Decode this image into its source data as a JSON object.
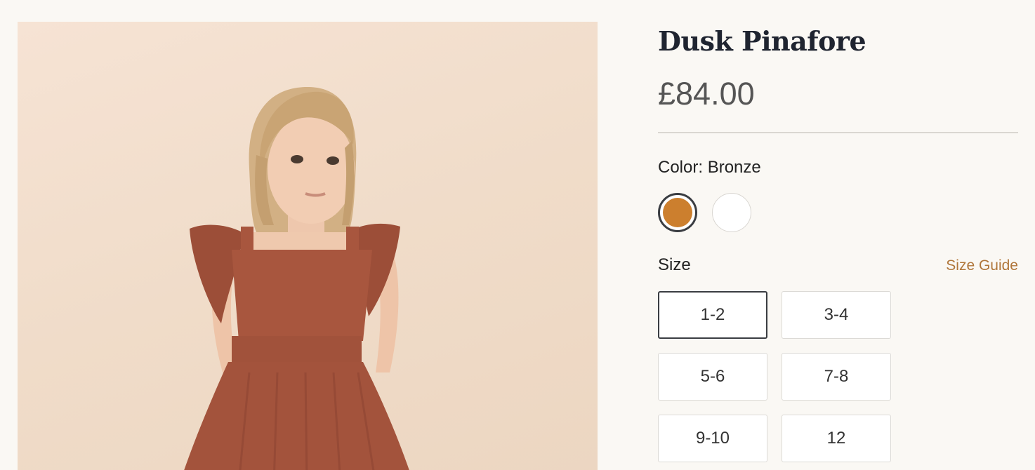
{
  "product": {
    "title": "Dusk Pinafore",
    "price": "£84.00",
    "image_alt": "child-wearing-rust-corduroy-pinafore"
  },
  "color": {
    "label": "Color: Bronze",
    "options": [
      {
        "name": "Bronze",
        "hex": "#cc7f2e",
        "selected": true
      },
      {
        "name": "White",
        "hex": "#ffffff",
        "selected": false
      }
    ]
  },
  "size": {
    "label": "Size",
    "guide_label": "Size Guide",
    "options": [
      {
        "label": "1-2",
        "selected": true
      },
      {
        "label": "3-4",
        "selected": false
      },
      {
        "label": "5-6",
        "selected": false
      },
      {
        "label": "7-8",
        "selected": false
      },
      {
        "label": "9-10",
        "selected": false
      },
      {
        "label": "12",
        "selected": false
      }
    ]
  },
  "colors": {
    "accent": "#b0763a",
    "selected_border": "#3a3d42",
    "background": "#faf8f4"
  }
}
